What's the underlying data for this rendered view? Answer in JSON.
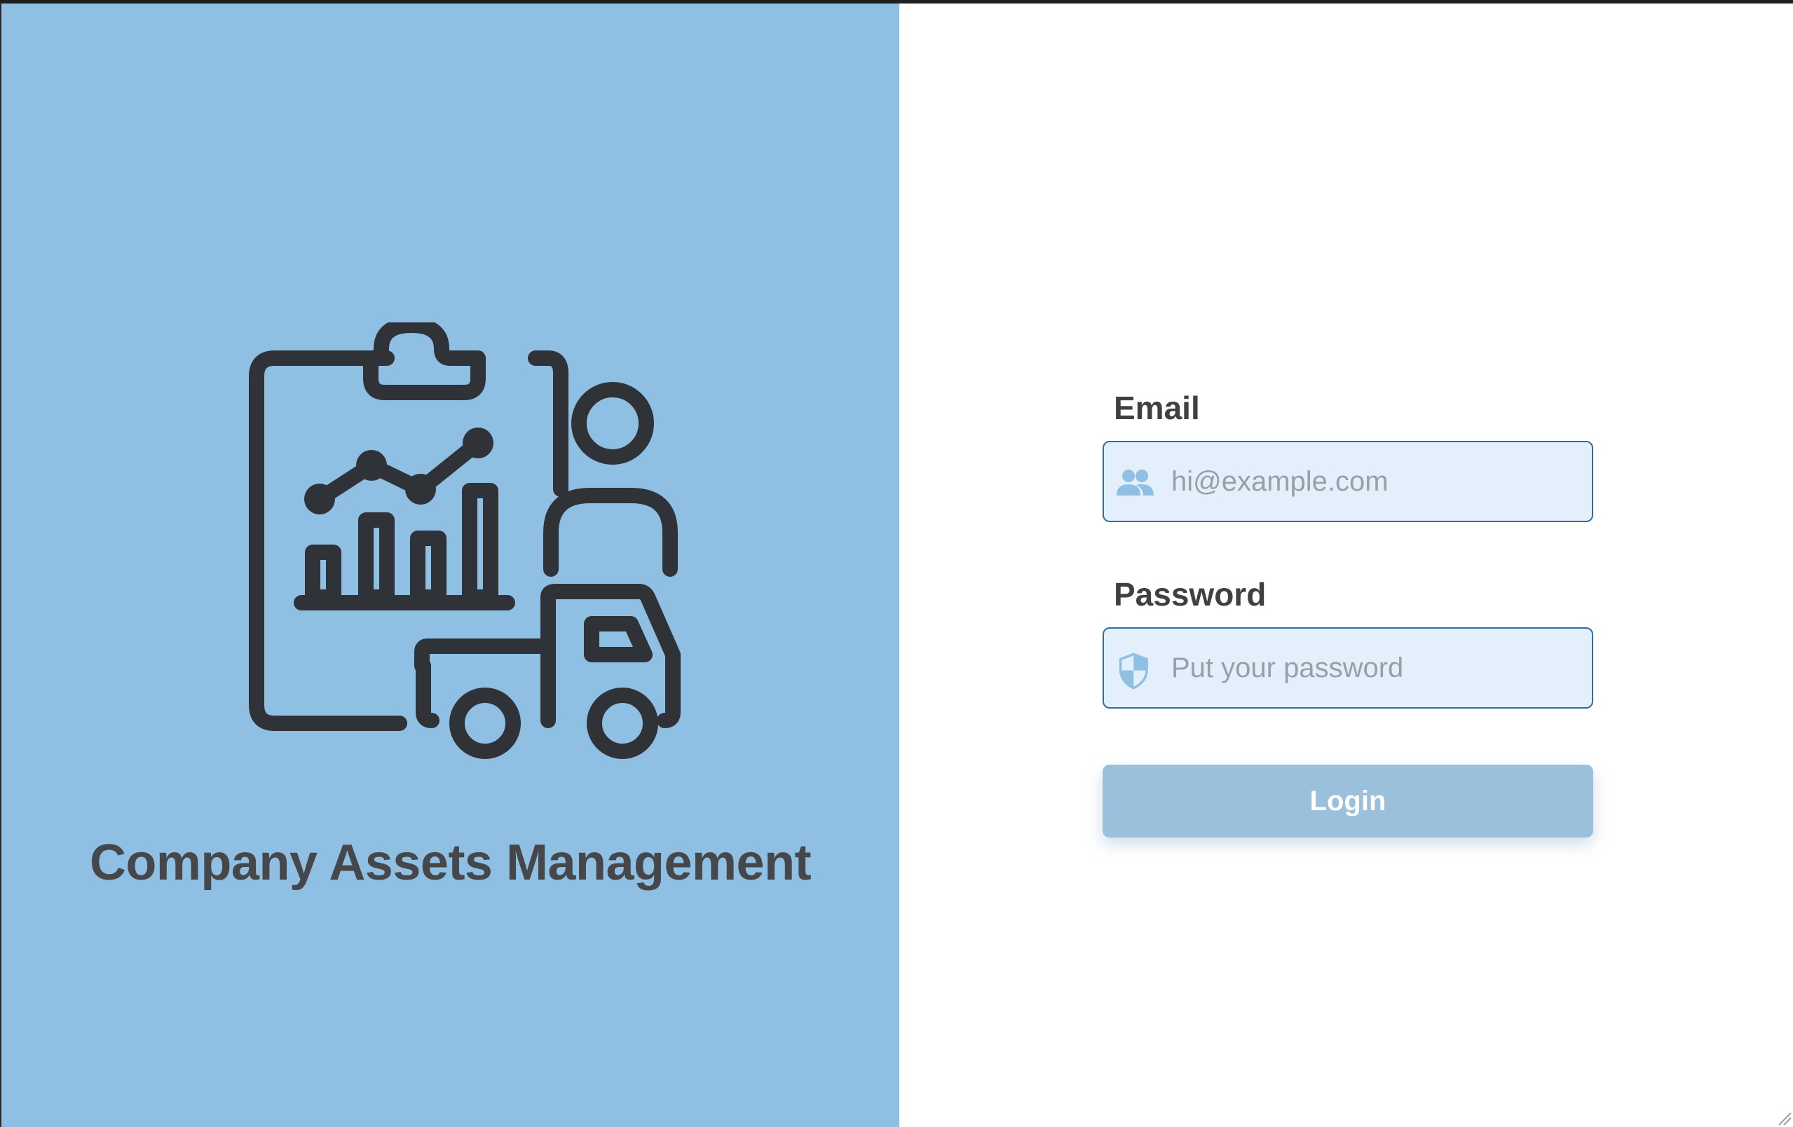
{
  "brand": {
    "title": "Company Assets Management",
    "logo_icon": "clipboard-chart-person-truck-icon",
    "panel_color": "#8fc0e4",
    "text_color": "#45474a"
  },
  "login_form": {
    "email": {
      "label": "Email",
      "placeholder": "hi@example.com",
      "value": "",
      "icon": "users-icon"
    },
    "password": {
      "label": "Password",
      "placeholder": "Put your password",
      "value": "",
      "icon": "shield-icon"
    },
    "submit_label": "Login",
    "accent_color": "#9bc0dc"
  }
}
